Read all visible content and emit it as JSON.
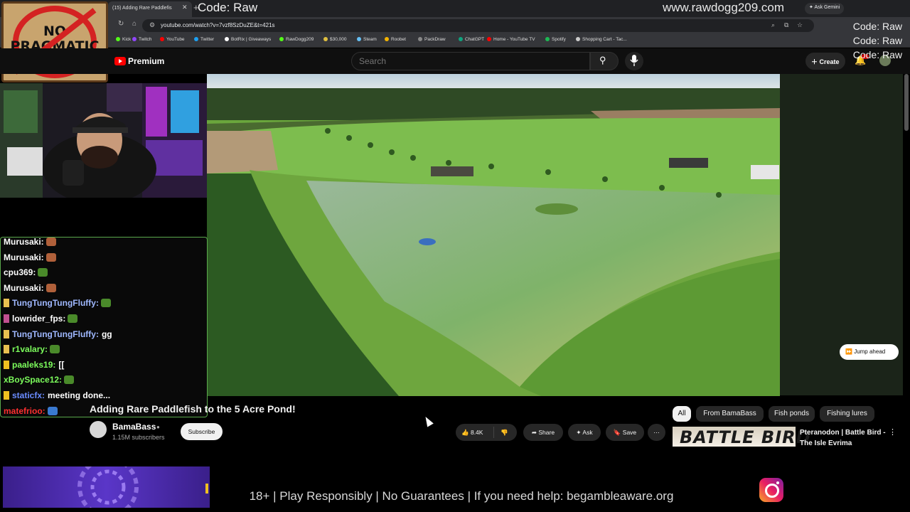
{
  "browser": {
    "tab_title": "(15) Adding Rare Paddlefis",
    "url": "youtube.com/watch?v=7vzf8SzDuZE&t=421s",
    "ask_gemini": "Ask Gemini",
    "bookmarks": [
      {
        "label": "Kick",
        "color": "#53fc18"
      },
      {
        "label": "Twitch",
        "color": "#9146ff"
      },
      {
        "label": "YouTube",
        "color": "#ff0000"
      },
      {
        "label": "Twitter",
        "color": "#1da1f2"
      },
      {
        "label": "BotRix | Giveaways",
        "color": "#ffffff"
      },
      {
        "label": "RawDogg209",
        "color": "#53fc18"
      },
      {
        "label": "$30,000",
        "color": "#e0c040"
      },
      {
        "label": "Steam",
        "color": "#66c0f4"
      },
      {
        "label": "Roobet",
        "color": "#f5b400"
      },
      {
        "label": "PackDraw",
        "color": "#888888"
      },
      {
        "label": "ChatGPT",
        "color": "#10a37f"
      },
      {
        "label": "Home - YouTube TV",
        "color": "#ff0000"
      },
      {
        "label": "Spotify",
        "color": "#1db954"
      },
      {
        "label": "Shopping Cart - Tac...",
        "color": "#cccccc"
      }
    ]
  },
  "overlay": {
    "code_label": "Code: Raw",
    "site": "www.rawdogg209.com",
    "code_stack": [
      "Code: Raw",
      "Code: Raw",
      "Code: Raw"
    ],
    "sign_text": "NO PRAGMATIC ZONE",
    "disclaimer": "18+ | Play Responsibly | No Guarantees | If you need help: begambleaware.org"
  },
  "youtube": {
    "brand": "Premium",
    "search_placeholder": "Search",
    "create_label": "Create",
    "jump_ahead": "Jump ahead",
    "video": {
      "title": "Adding Rare Paddlefish to the 5 Acre Pond!",
      "channel": "BamaBass",
      "subscribers": "1.15M subscribers",
      "subscribe_label": "Subscribe",
      "likes": "8.4K",
      "share_label": "Share",
      "ask_label": "Ask",
      "save_label": "Save"
    },
    "chips": [
      "All",
      "From BamaBass",
      "Fish ponds",
      "Fishing lures"
    ],
    "recommendation": {
      "thumb_text": "BATTLE BIRD",
      "title": "Pteranodon | Battle Bird - The Isle Evrima"
    }
  },
  "chat": [
    {
      "user": "Murusaki:",
      "color": "#ffffff",
      "msg": "",
      "emote": "#b0603a",
      "badge": ""
    },
    {
      "user": "Murusaki:",
      "color": "#ffffff",
      "msg": "",
      "emote": "#b0603a",
      "badge": ""
    },
    {
      "user": "cpu369:",
      "color": "#ffffff",
      "msg": "",
      "emote": "#4a8a2a",
      "badge": ""
    },
    {
      "user": "Murusaki:",
      "color": "#ffffff",
      "msg": "",
      "emote": "#b0603a",
      "badge": ""
    },
    {
      "user": "TungTungTungFluffy:",
      "color": "#9fb8ff",
      "msg": "",
      "emote": "#4a8a2a",
      "badge": "#e8c050"
    },
    {
      "user": "lowrider_fps:",
      "color": "#ffffff",
      "msg": "",
      "emote": "#4a8a2a",
      "badge": "#c05090"
    },
    {
      "user": "TungTungTungFluffy:",
      "color": "#9fb8ff",
      "msg": "gg",
      "emote": "",
      "badge": "#e8c050"
    },
    {
      "user": "r1valary:",
      "color": "#7cfc5c",
      "msg": "",
      "emote": "#4a8a2a",
      "badge": "#e8c050"
    },
    {
      "user": "paaleks19:",
      "color": "#7cfc5c",
      "msg": "[[",
      "emote": "",
      "badge": "#f0c020"
    },
    {
      "user": "xBoySpace12:",
      "color": "#7cfc5c",
      "msg": "",
      "emote": "#4a8a2a",
      "badge": ""
    },
    {
      "user": "staticfx:",
      "color": "#6a8cff",
      "msg": "meeting done...",
      "emote": "",
      "badge": "#f0c020"
    },
    {
      "user": "matefrioo:",
      "color": "#ff3030",
      "msg": "",
      "emote": "#3a7ad0",
      "badge": ""
    }
  ]
}
